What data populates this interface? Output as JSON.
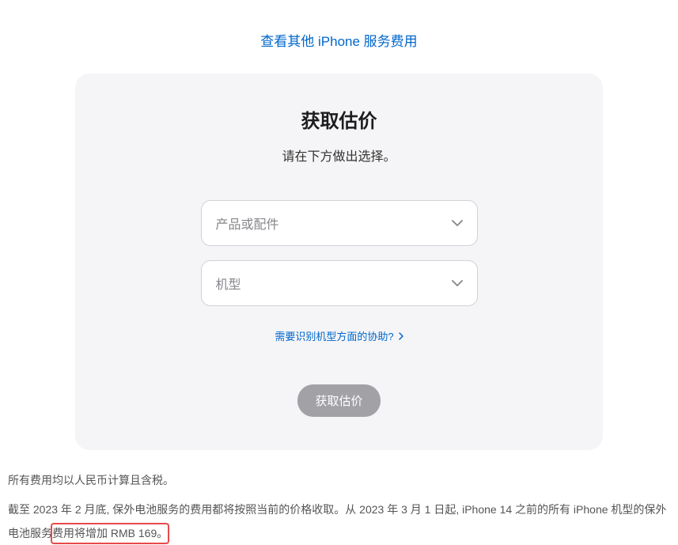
{
  "topLink": {
    "label": "查看其他 iPhone 服务费用"
  },
  "card": {
    "title": "获取估价",
    "subtitle": "请在下方做出选择。",
    "select1": {
      "placeholder": "产品或配件"
    },
    "select2": {
      "placeholder": "机型"
    },
    "helpLink": {
      "label": "需要识别机型方面的协助?"
    },
    "button": {
      "label": "获取估价"
    }
  },
  "footer": {
    "line1": "所有费用均以人民币计算且含税。",
    "line2a": "截至 2023 年 2 月底, 保外电池服务的费用都将按照当前的价格收取。从 2023 年 3 月 1 日起, iPhone 14 之前的所有 iPhone 机型的保外电池服务",
    "line2b": "费用将增加 RMB 169。"
  }
}
